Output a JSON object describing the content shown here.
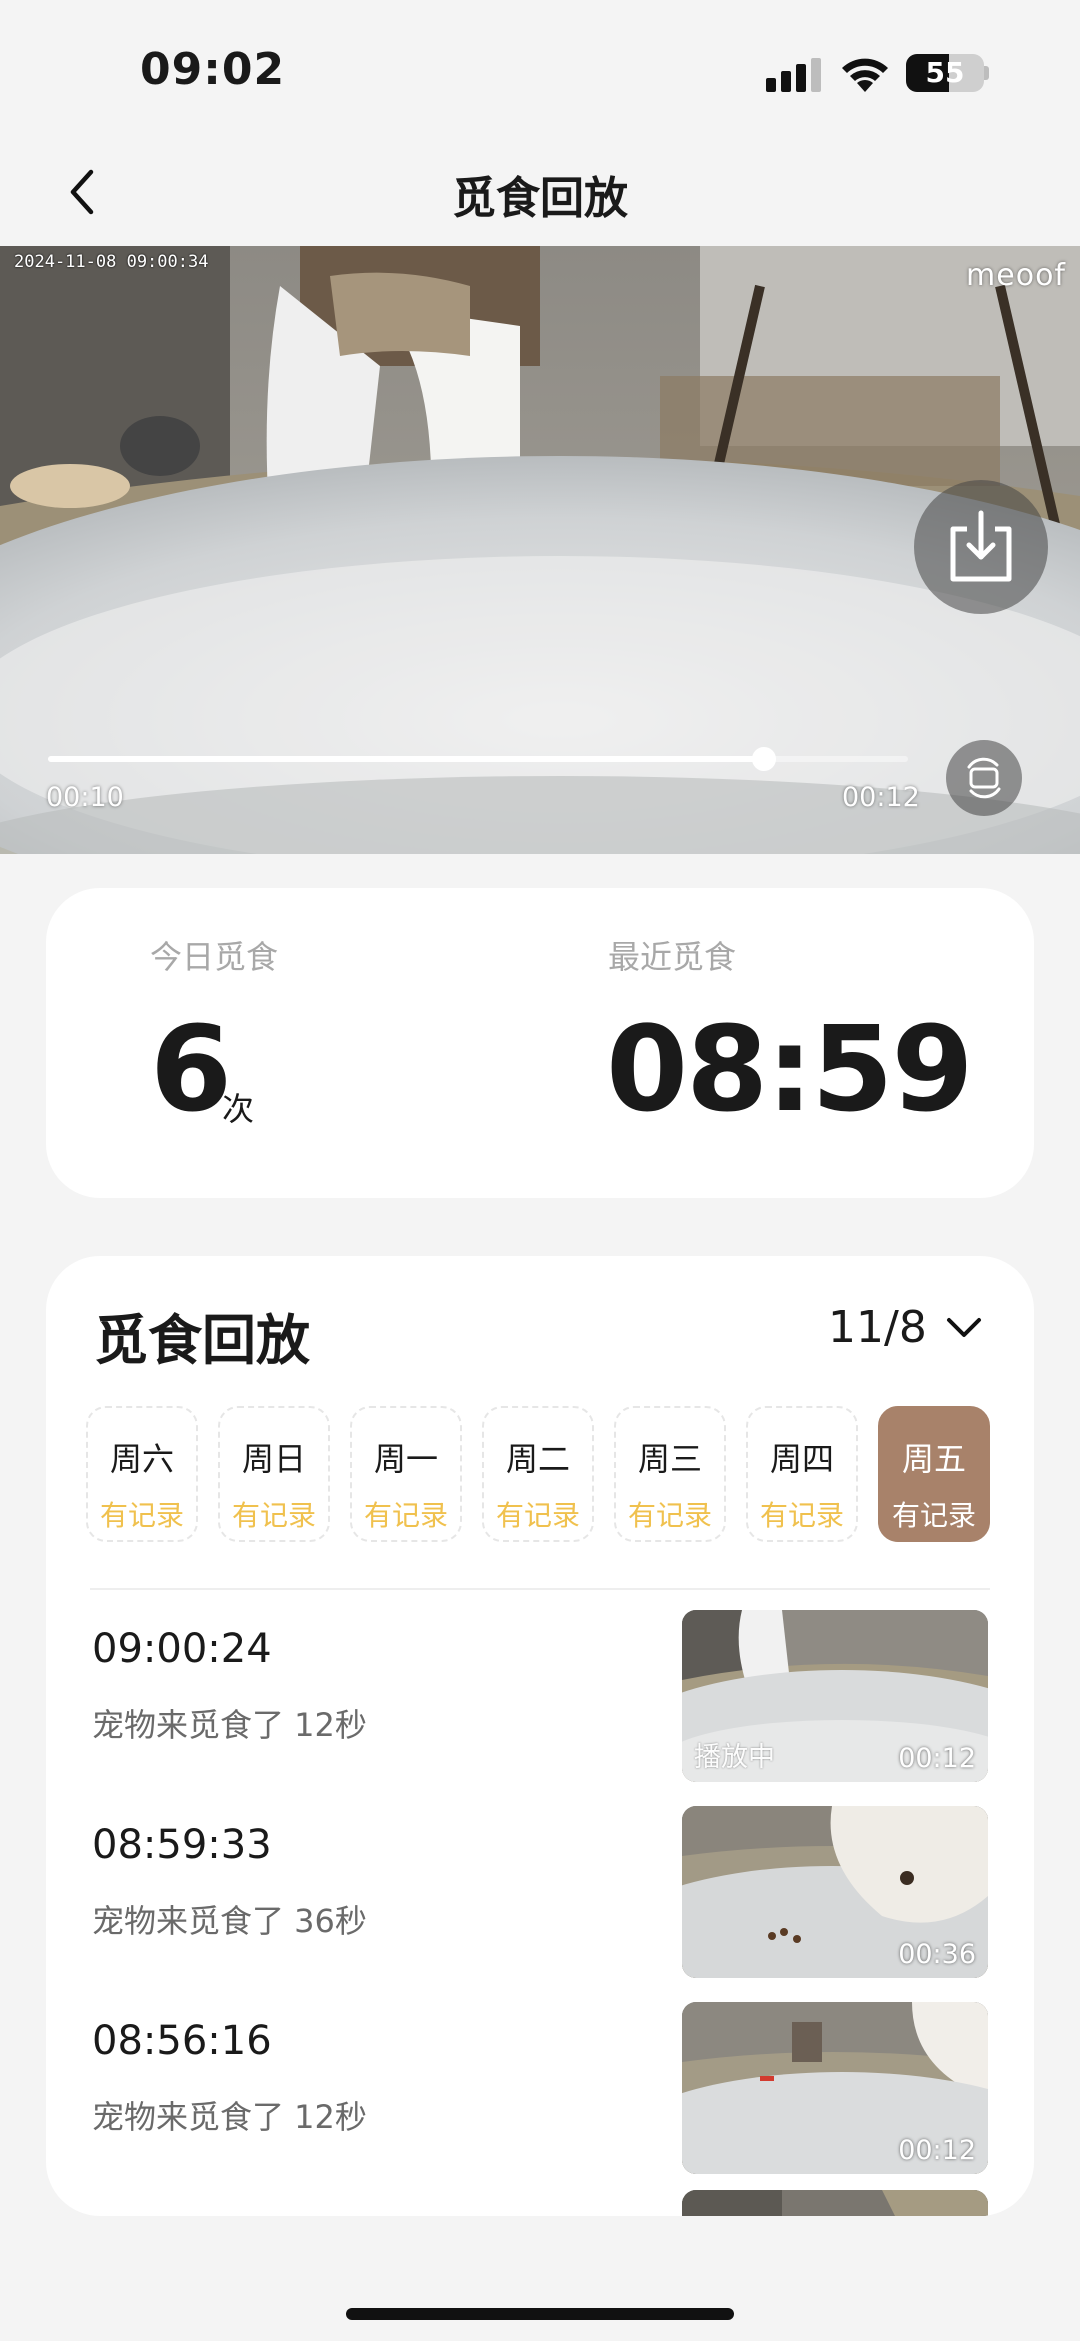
{
  "status_bar": {
    "time": "09:02",
    "battery_level": 55,
    "battery_text": "55",
    "icons": [
      "signal-icon",
      "wifi-icon",
      "battery-icon"
    ]
  },
  "nav": {
    "title": "觅食回放",
    "back_icon": "chevron-left-icon"
  },
  "video": {
    "timestamp": "2024-11-08 09:00:34",
    "watermark": "meoof",
    "current_time": "00:10",
    "total_time": "00:12",
    "progress": 0.833,
    "download_icon": "download-icon",
    "rotate_icon": "rotate-screen-icon"
  },
  "stats": {
    "today_label": "今日觅食",
    "today_count": "6",
    "today_unit": "次",
    "recent_label": "最近觅食",
    "recent_time": "08:59"
  },
  "playback": {
    "title": "觅食回放",
    "date": "11/8",
    "days": [
      {
        "name": "周六",
        "status": "有记录",
        "active": false
      },
      {
        "name": "周日",
        "status": "有记录",
        "active": false
      },
      {
        "name": "周一",
        "status": "有记录",
        "active": false
      },
      {
        "name": "周二",
        "status": "有记录",
        "active": false
      },
      {
        "name": "周三",
        "status": "有记录",
        "active": false
      },
      {
        "name": "周四",
        "status": "有记录",
        "active": false
      },
      {
        "name": "周五",
        "status": "有记录",
        "active": true
      }
    ],
    "records": [
      {
        "time": "09:00:24",
        "desc": "宠物来觅食了 12秒",
        "duration": "00:12",
        "status": "播放中"
      },
      {
        "time": "08:59:33",
        "desc": "宠物来觅食了 36秒",
        "duration": "00:36",
        "status": ""
      },
      {
        "time": "08:56:16",
        "desc": "宠物来觅食了 12秒",
        "duration": "00:12",
        "status": ""
      }
    ]
  },
  "colors": {
    "accent": "#a8826a",
    "record_status": "#f0c14e",
    "background": "#f4f4f4"
  }
}
